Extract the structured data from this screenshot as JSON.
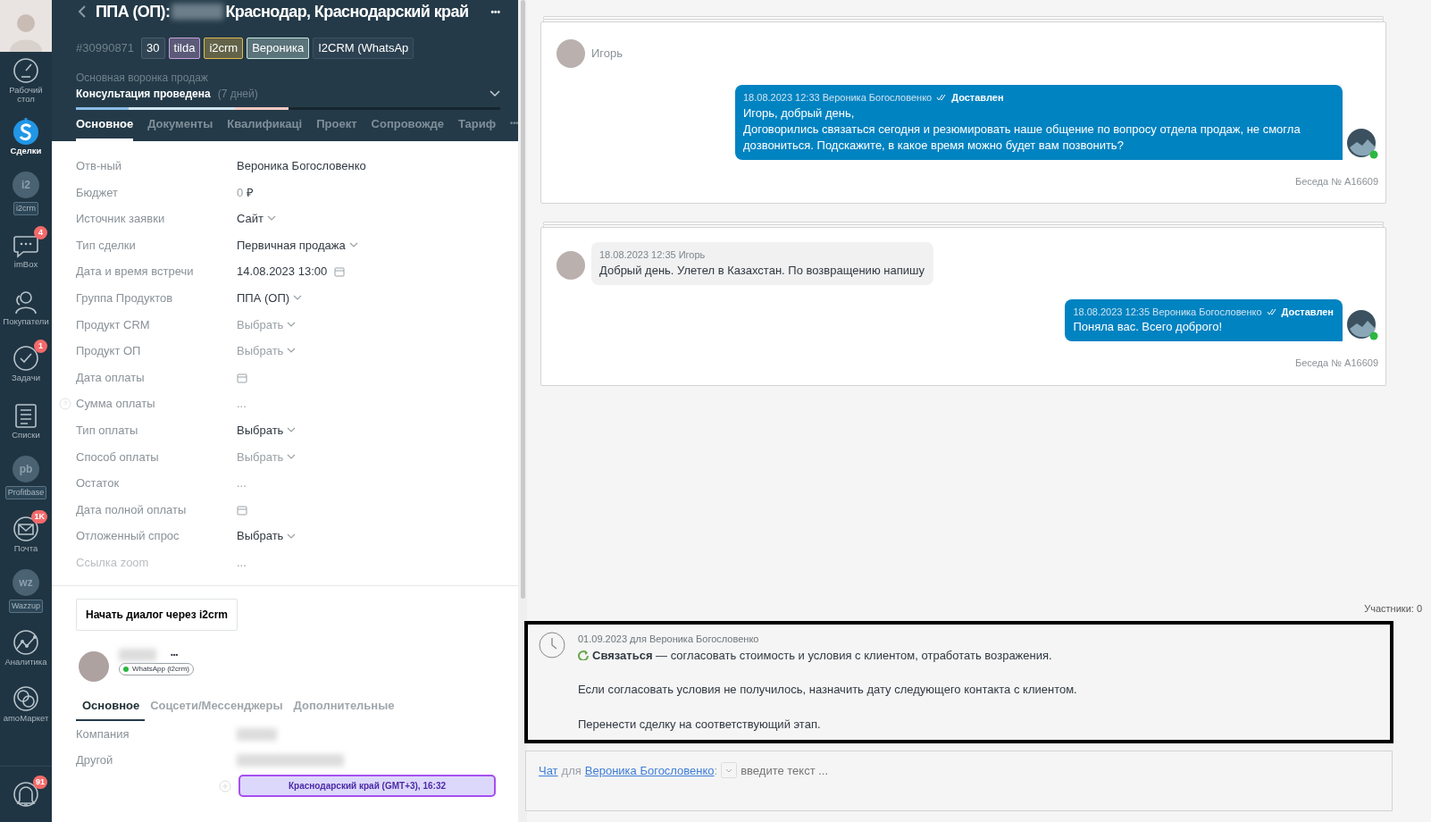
{
  "sidebar": {
    "items": [
      {
        "kind": "nav",
        "label": "Рабочий стол",
        "selected": false
      },
      {
        "kind": "nav",
        "label": "Сделки",
        "selected": true
      },
      {
        "kind": "app",
        "glyph": "i2",
        "label": "i2crm",
        "selected": false
      },
      {
        "kind": "nav",
        "label": "imBox",
        "badge": "4",
        "selected": false
      },
      {
        "kind": "nav",
        "label": "Покупатели",
        "selected": false
      },
      {
        "kind": "nav",
        "label": "Задачи",
        "badge": "1",
        "selected": false
      },
      {
        "kind": "nav",
        "label": "Списки",
        "selected": false
      },
      {
        "kind": "app",
        "glyph": "pb",
        "label": "Profitbase",
        "selected": false
      },
      {
        "kind": "nav",
        "label": "Почта",
        "badge": "1K",
        "selected": false
      },
      {
        "kind": "app",
        "glyph": "wz",
        "label": "Wazzup",
        "selected": false
      },
      {
        "kind": "nav",
        "label": "Аналитика",
        "selected": false
      },
      {
        "kind": "nav",
        "label": "amoМаркет",
        "selected": false
      },
      {
        "kind": "bell",
        "badge": "91",
        "selected": false
      }
    ]
  },
  "deal": {
    "title_prefix": "ППА (ОП):",
    "title_suffix": "Краснодар, Краснодарский край",
    "more": "•••",
    "id": "#30990871",
    "tags": [
      {
        "text": "30",
        "color": "#4a5d6c"
      },
      {
        "text": "tilda",
        "color": "#c9a0dc"
      },
      {
        "text": "i2crm",
        "color": "#e0b84a"
      },
      {
        "text": "Вероника",
        "color": "#c8e6df"
      },
      {
        "text": "I2CRM (WhatsAp",
        "color": "#3d5262"
      }
    ],
    "pipeline": "Основная воронка продаж",
    "stage": "Консультация проведена",
    "duration": "(7 дней)",
    "level": 0.5,
    "tabs": [
      {
        "label": "Основное",
        "selected": true
      },
      {
        "label": "Документы",
        "selected": false
      },
      {
        "label": "Квалификаці",
        "selected": false
      },
      {
        "label": "Проект",
        "selected": false
      },
      {
        "label": "Сопровожде",
        "selected": false
      },
      {
        "label": "Тариф",
        "selected": false
      }
    ],
    "tabs_more": "•••",
    "fields": [
      {
        "label": "Отв-ный",
        "kind": "text",
        "value": "Вероника Богословенко",
        "muted": false
      },
      {
        "label": "Бюджет",
        "kind": "money",
        "value": "0",
        "currency": "₽",
        "muted": true
      },
      {
        "label": "Источник заявки",
        "kind": "select",
        "value": "Сайт",
        "muted": false
      },
      {
        "label": "Тип сделки",
        "kind": "select",
        "value": "Первичная продажа",
        "muted": false
      },
      {
        "label": "Дата и время встречи",
        "kind": "date",
        "value": "14.08.2023 13:00",
        "muted": false
      },
      {
        "label": "Группа Продуктов",
        "kind": "select",
        "value": "ППА (ОП)",
        "muted": false
      },
      {
        "label": "Продукт CRM",
        "kind": "select",
        "value": "Выбрать",
        "muted": true
      },
      {
        "label": "Продукт ОП",
        "kind": "select",
        "value": "Выбрать",
        "muted": true
      },
      {
        "label": "Дата оплаты",
        "kind": "date",
        "muted": true
      },
      {
        "label": "Сумма оплаты",
        "kind": "text",
        "value": "...",
        "muted": true,
        "help": true
      },
      {
        "label": "Тип оплаты",
        "kind": "select",
        "value": "Выбрать",
        "muted": false
      },
      {
        "label": "Способ оплаты",
        "kind": "select",
        "value": "Выбрать",
        "muted": true
      },
      {
        "label": "Остаток",
        "kind": "text",
        "value": "...",
        "muted": true
      },
      {
        "label": "Дата полной оплаты",
        "kind": "date",
        "muted": true
      },
      {
        "label": "Отложенный спрос",
        "kind": "select",
        "value": "Выбрать",
        "muted": false
      },
      {
        "label": "Ссылка zoom",
        "kind": "text",
        "value": "...",
        "muted": true,
        "disabled": true
      }
    ],
    "dialog_button": "Начать диалог через i2crm",
    "contact": {
      "more": "•••",
      "channel": "WhatsApp (i2crm)",
      "tabs": [
        {
          "label": "Основное",
          "selected": true
        },
        {
          "label": "Соцсети/Мессенджеры",
          "selected": false
        },
        {
          "label": "Дополнительные",
          "selected": false
        }
      ],
      "fields": [
        {
          "label": "Компания"
        },
        {
          "label": "Другой"
        }
      ],
      "timezone": "Краснодарский край (GMT+3), 16:32"
    }
  },
  "feed": {
    "conversations": [
      {
        "contact": "Игорь",
        "footer": "Беседа № A16609",
        "messages": [
          {
            "kind": "outgoing",
            "time": "18.08.2023 12:33",
            "author": "Вероника Богословенко",
            "status": "Доставлен",
            "text": "Игорь, добрый день,\nДоговорились связаться сегодня и резюмировать наше общение по вопросу отдела продаж, не смогла дозвониться. Подскажите, в какое время можно будет вам позвонить?"
          }
        ]
      },
      {
        "footer": "Беседа № A16609",
        "messages": [
          {
            "kind": "incoming",
            "time": "18.08.2023 12:35",
            "author": "Игорь",
            "text": "Добрый день. Улетел в Казахстан. По возвращению напишу"
          },
          {
            "kind": "outgoing",
            "time": "18.08.2023 12:35",
            "author": "Вероника Богословенко",
            "status": "Доставлен",
            "text": "Поняла вас. Всего доброго!"
          }
        ]
      }
    ],
    "participants": "Участники: 0",
    "task": {
      "meta": "01.09.2023 для Вероника Богословенко",
      "type": "Связаться",
      "text": " — согласовать стоимость и условия с клиентом, отработать возражения.",
      "paragraphs": [
        "Если согласовать условия не получилось, назначить дату следующего контакта с клиентом.",
        "Перенести сделку на соответствующий этап."
      ]
    },
    "composer": {
      "mode": "Чат",
      "for": "для",
      "recipient": "Вероника Богословенко",
      "colon": ":",
      "placeholder": "введите текст ..."
    }
  }
}
